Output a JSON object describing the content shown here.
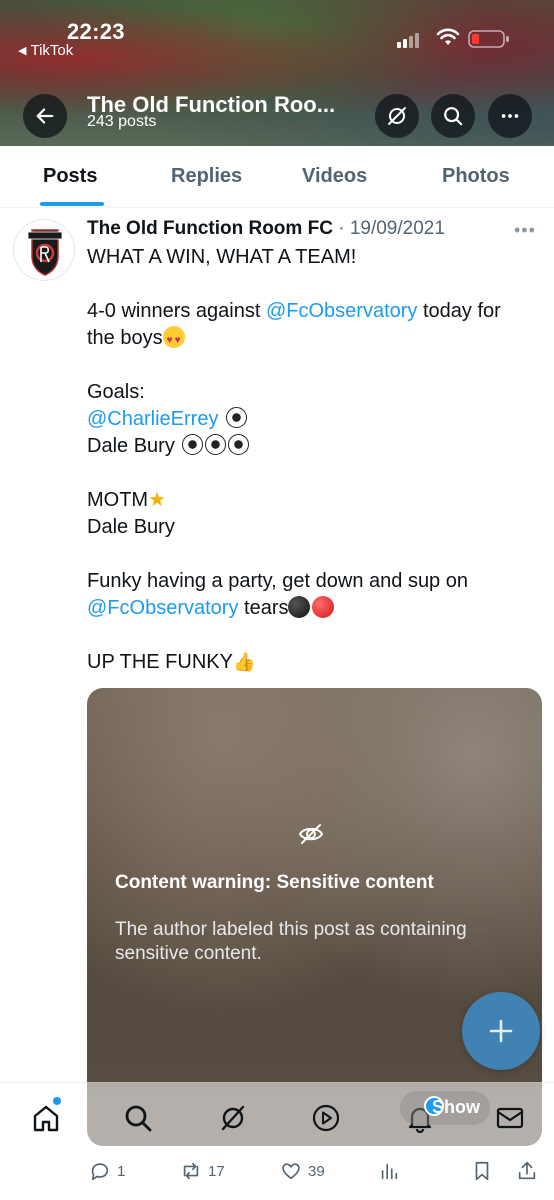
{
  "status_bar": {
    "time": "22:23",
    "back_app": "TikTok",
    "back_arrow": "◀"
  },
  "profile": {
    "name": "The Old Function Roo...",
    "post_count": "243 posts"
  },
  "tabs": [
    {
      "label": "Posts",
      "active": true
    },
    {
      "label": "Replies",
      "active": false
    },
    {
      "label": "Videos",
      "active": false
    },
    {
      "label": "Photos",
      "active": false
    }
  ],
  "post": {
    "author": "The Old Function Room FC",
    "separator": " · ",
    "date": "19/09/2021",
    "more": "•••",
    "lines": {
      "l1": "WHAT A WIN, WHAT A TEAM!",
      "l2a": "4-0 winners against ",
      "l2_mention": "@FcObservatory",
      "l2b": " today for",
      "l3": "the boys",
      "l4": "Goals:",
      "l5_mention": "@CharlieErrey",
      "l6": "Dale Bury",
      "l7": "MOTM",
      "l8": "Dale Bury",
      "l9": "Funky having a party, get down and sup on",
      "l10_mention": "@FcObservatory",
      "l10b": " tears",
      "l11": "UP THE FUNKY"
    },
    "emojis": {
      "star": "★",
      "thumbs": "👍"
    },
    "media": {
      "warning_title": "Content warning: Sensitive content",
      "warning_desc": "The author labeled this post as containing sensitive content.",
      "show_label": "Show"
    },
    "stats": {
      "replies": "1",
      "reposts": "17",
      "likes": "39"
    }
  },
  "colors": {
    "accent": "#1d9bf0",
    "text": "#0f1419",
    "muted": "#536471"
  },
  "icons": [
    "back-arrow-icon",
    "hide-icon",
    "search-icon",
    "more-icon",
    "home-icon",
    "search-icon",
    "grok-icon",
    "video-icon",
    "bell-icon",
    "mail-icon",
    "reply-icon",
    "repost-icon",
    "like-icon",
    "views-icon",
    "bookmark-icon",
    "share-icon",
    "plus-icon"
  ]
}
